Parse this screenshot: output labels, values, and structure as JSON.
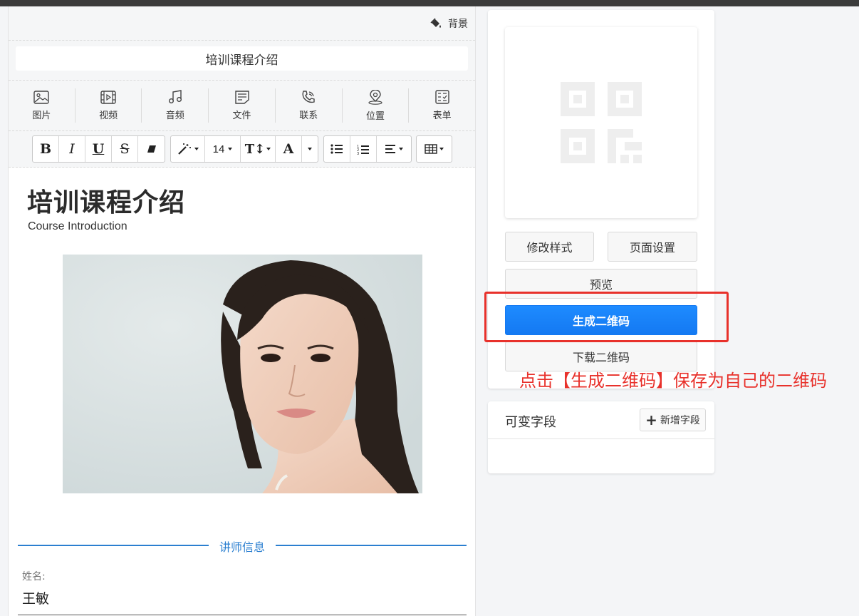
{
  "editor": {
    "background_label": "背景",
    "title_value": "培训课程介绍",
    "tools": [
      {
        "label": "图片",
        "icon": "image-icon"
      },
      {
        "label": "视频",
        "icon": "video-icon"
      },
      {
        "label": "音频",
        "icon": "music-icon"
      },
      {
        "label": "文件",
        "icon": "file-icon"
      },
      {
        "label": "联系",
        "icon": "phone-icon"
      },
      {
        "label": "位置",
        "icon": "location-icon"
      },
      {
        "label": "表单",
        "icon": "form-icon"
      }
    ],
    "format": {
      "bold": "B",
      "italic": "I",
      "underline": "U",
      "strike": "S",
      "font_size": "14",
      "text_size": "T↕",
      "font_color": "A"
    }
  },
  "content": {
    "heading": "培训课程介绍",
    "subtitle": "Course Introduction",
    "section_title": "讲师信息",
    "field_label": "姓名:",
    "field_value": "王敏"
  },
  "sidebar": {
    "modify_style": "修改样式",
    "page_settings": "页面设置",
    "preview": "预览",
    "generate_qr": "生成二维码",
    "download_qr": "下载二维码"
  },
  "annotation": "点击【生成二维码】保存为自己的二维码",
  "variable_fields": {
    "title": "可变字段",
    "add_label": "新增字段"
  },
  "colors": {
    "accent": "#1479f2",
    "section": "#2b7fd0",
    "annotation": "#e8312b"
  }
}
